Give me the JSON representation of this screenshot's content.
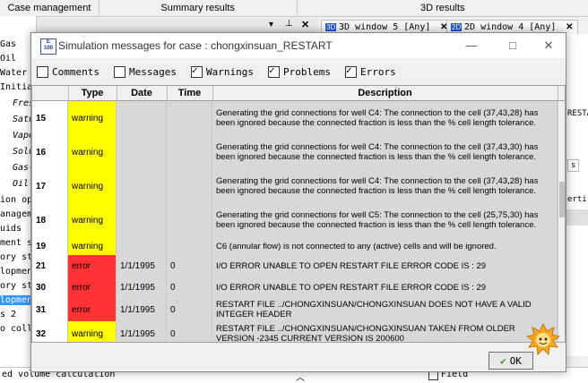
{
  "topbar": {
    "tabs": [
      "Case management",
      "Summary results",
      "3D results"
    ]
  },
  "viewtabs": [
    {
      "icon": "3D",
      "label": "3D window 5 [Any]"
    },
    {
      "icon": "2D",
      "label": "2D window 4 [Any]"
    }
  ],
  "left_tree": [
    "Gas",
    "Oil",
    "Water",
    "Initial",
    "Fres",
    "Satu",
    "Vapo",
    "Solu",
    "Gas-",
    "Oil-",
    "ion ope",
    "anageme",
    "uids",
    "ment st",
    "ory str",
    "lopment",
    "ory str",
    "lopment",
    "s 2",
    "o colle"
  ],
  "right_panel": {
    "restart_label": "RESTART",
    "s_label": "s",
    "verti_label": "erti"
  },
  "bottom": {
    "status_text": "ed volume calculation",
    "field_label": "Field"
  },
  "dialog": {
    "title": "Simulation messages for case : chongxinsuan_RESTART",
    "logo_text": "Eclipse 100",
    "minimize": "—",
    "maximize": "□",
    "close": "✕",
    "filters": [
      {
        "label": "Comments",
        "checked": false
      },
      {
        "label": "Messages",
        "checked": false
      },
      {
        "label": "Warnings",
        "checked": true
      },
      {
        "label": "Problems",
        "checked": true
      },
      {
        "label": "Errors",
        "checked": true
      }
    ],
    "columns": {
      "num": "",
      "type": "Type",
      "date": "Date",
      "time": "Time",
      "description": "Description"
    },
    "rows": [
      {
        "num": "15",
        "type": "warning",
        "date": "",
        "time": "",
        "description": "Generating the grid connections for well C4: The connection to the cell (37,43,28) has been ignored because the connected fraction is less than the % cell length tolerance."
      },
      {
        "num": "16",
        "type": "warning",
        "date": "",
        "time": "",
        "description": "Generating the grid connections for well C4: The connection to the cell (37,43,30) has been ignored because the connected fraction is less than the % cell length tolerance."
      },
      {
        "num": "17",
        "type": "warning",
        "date": "",
        "time": "",
        "description": "Generating the grid connections for well C4: The connection to the cell (37,43,28) has been ignored because the connected fraction is less than the % cell length tolerance."
      },
      {
        "num": "18",
        "type": "warning",
        "date": "",
        "time": "",
        "description": "Generating the grid connections for well C5: The connection to the cell (25,75,30) has been ignored because the connected fraction is less than the % cell length tolerance."
      },
      {
        "num": "19",
        "type": "warning",
        "date": "",
        "time": "",
        "description": "C6 (annular flow) is not connected to any (active) cells and will be ignored."
      },
      {
        "num": "21",
        "type": "error",
        "date": "1/1/1995",
        "time": "0",
        "description": "I/O ERROR UNABLE TO OPEN RESTART FILE ERROR CODE IS : 29"
      },
      {
        "num": "30",
        "type": "error",
        "date": "1/1/1995",
        "time": "0",
        "description": "I/O ERROR UNABLE TO OPEN RESTART FILE ERROR CODE IS : 29"
      },
      {
        "num": "31",
        "type": "error",
        "date": "1/1/1995",
        "time": "0",
        "description": "RESTART FILE ../CHONGXINSUAN/CHONGXINSUAN DOES NOT HAVE A VALID INTEGER HEADER"
      },
      {
        "num": "32",
        "type": "warning",
        "date": "1/1/1995",
        "time": "0",
        "description": "RESTART FILE ../CHONGXINSUAN/CHONGXINSUAN TAKEN FROM OLDER VERSION -2345 CURRENT VERSION IS 200600"
      }
    ],
    "ok_label": "OK"
  }
}
